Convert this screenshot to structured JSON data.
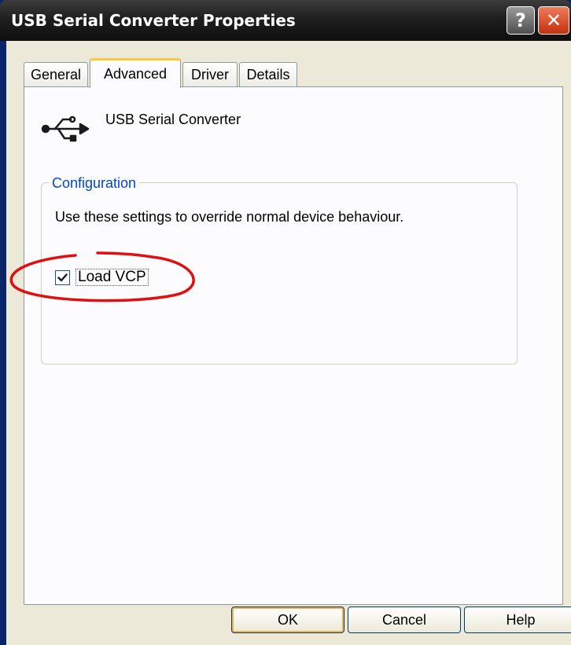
{
  "window": {
    "title": "USB Serial Converter Properties",
    "help_glyph": "?",
    "close_glyph": "✕"
  },
  "tabs": [
    {
      "label": "General",
      "active": false
    },
    {
      "label": "Advanced",
      "active": true
    },
    {
      "label": "Driver",
      "active": false
    },
    {
      "label": "Details",
      "active": false
    }
  ],
  "device": {
    "icon": "usb-icon",
    "name": "USB Serial Converter"
  },
  "configuration": {
    "group_label": "Configuration",
    "description": "Use these settings to override normal device behaviour.",
    "load_vcp": {
      "label": "Load VCP",
      "checked": true
    }
  },
  "buttons": {
    "ok": "OK",
    "cancel": "Cancel",
    "help": "Help"
  },
  "colors": {
    "titlebar": "#1f1f1f",
    "client": "#ece9d8",
    "group_label": "#0046d5",
    "annotation": "#e01010"
  }
}
